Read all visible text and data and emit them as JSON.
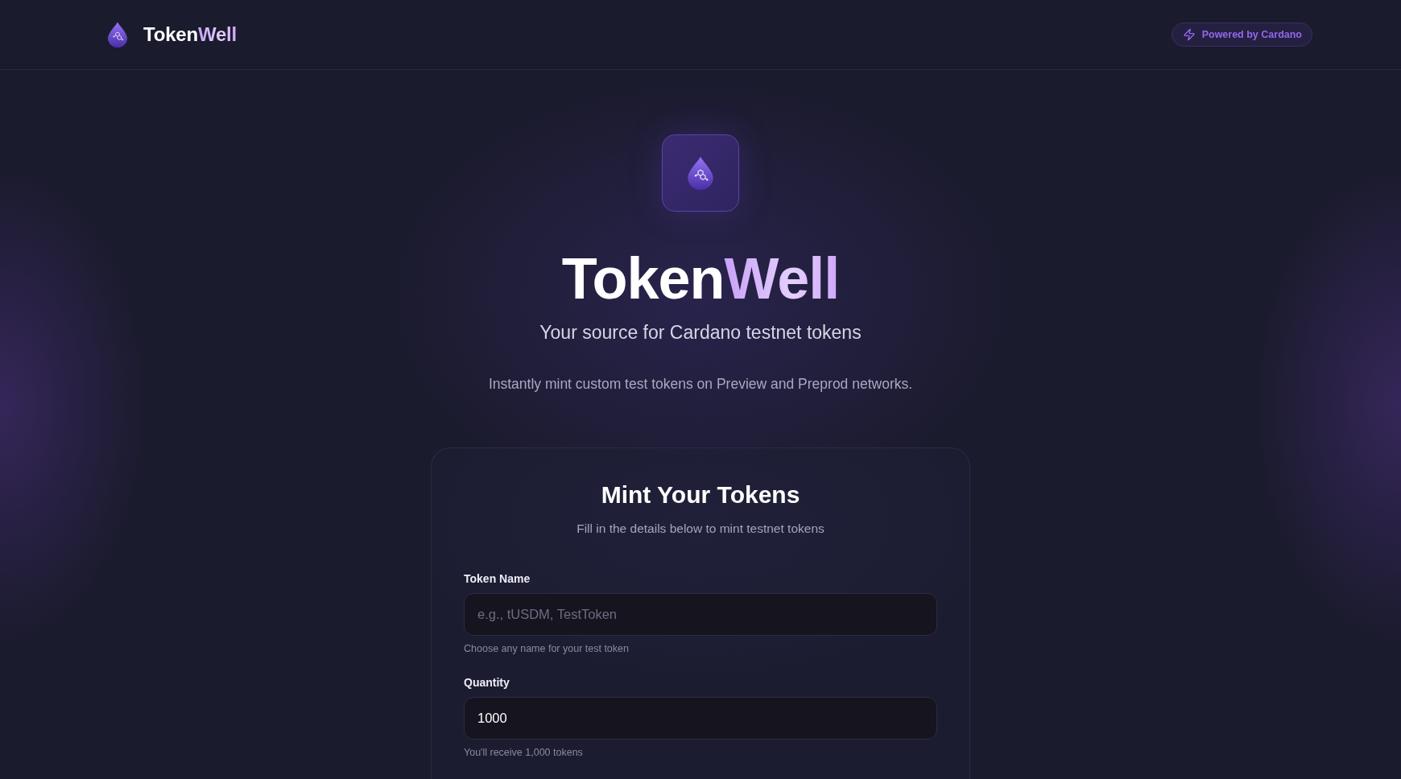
{
  "header": {
    "brand": {
      "primary": "Token",
      "accent": "Well"
    },
    "badge": "Powered by Cardano"
  },
  "hero": {
    "title": {
      "primary": "Token",
      "accent": "Well"
    },
    "subtitle": "Your source for Cardano testnet tokens",
    "description": "Instantly mint custom test tokens on Preview and Preprod networks."
  },
  "form": {
    "title": "Mint Your Tokens",
    "subtitle": "Fill in the details below to mint testnet tokens",
    "fields": [
      {
        "label": "Token Name",
        "placeholder": "e.g., tUSDM, TestToken",
        "hint": "Choose any name for your test token"
      },
      {
        "label": "Quantity",
        "value": "1000",
        "hint": "You'll receive 1,000 tokens"
      }
    ]
  }
}
